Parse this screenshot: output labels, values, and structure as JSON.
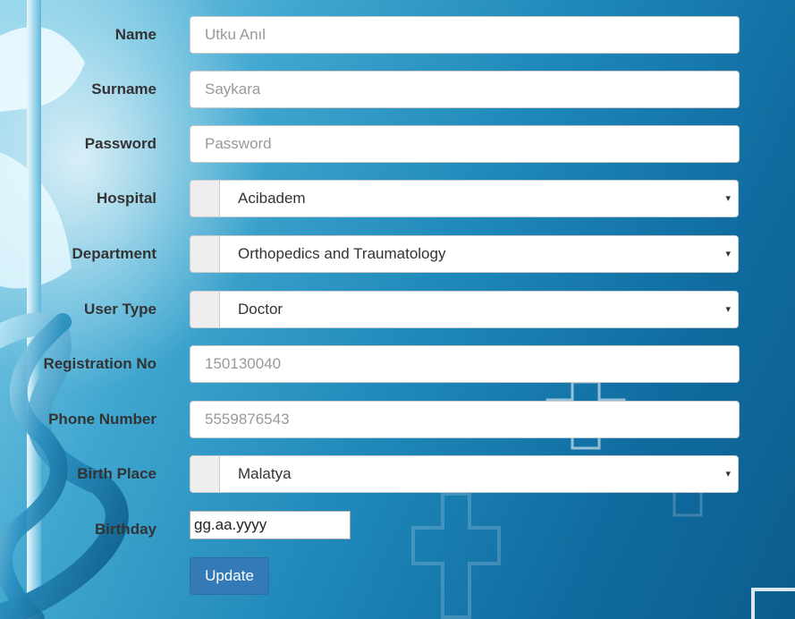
{
  "form": {
    "name": {
      "label": "Name",
      "placeholder": "Utku Anıl"
    },
    "surname": {
      "label": "Surname",
      "placeholder": "Saykara"
    },
    "password": {
      "label": "Password",
      "placeholder": "Password"
    },
    "hospital": {
      "label": "Hospital",
      "value": "Acibadem"
    },
    "department": {
      "label": "Department",
      "value": "Orthopedics and Traumatology"
    },
    "user_type": {
      "label": "User Type",
      "value": "Doctor"
    },
    "registration_no": {
      "label": "Registration No",
      "placeholder": "150130040"
    },
    "phone_number": {
      "label": "Phone Number",
      "placeholder": "5559876543"
    },
    "birth_place": {
      "label": "Birth Place",
      "value": "Malatya"
    },
    "birthday": {
      "label": "Birthday",
      "value": "gg.aa.yyyy"
    }
  },
  "actions": {
    "update_label": "Update"
  },
  "icons": {
    "dropdown_arrow": "▾"
  },
  "colors": {
    "primary_button": "#337ab7",
    "background_accent": "#1e86b8"
  }
}
